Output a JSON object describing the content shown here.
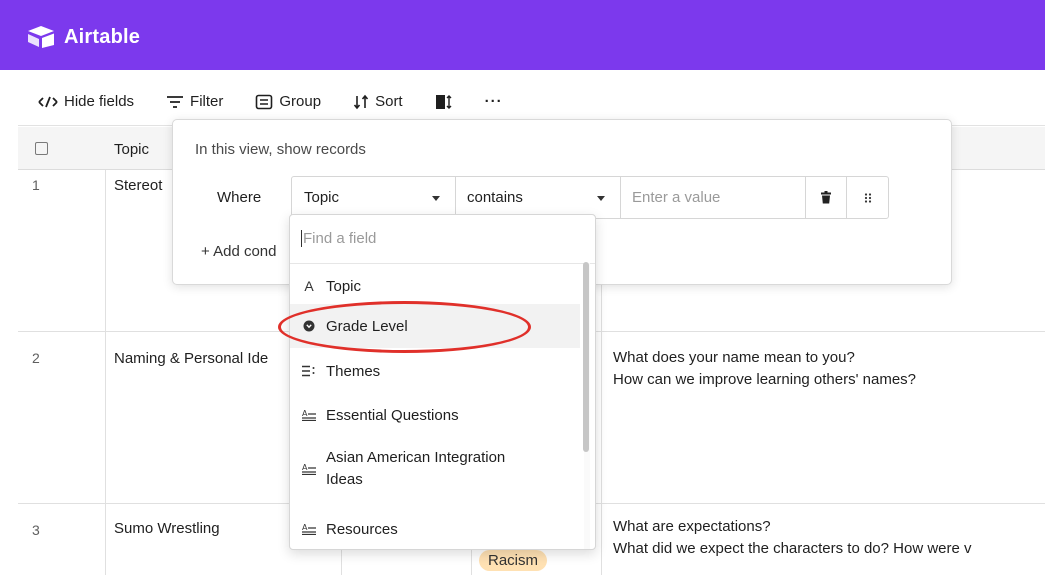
{
  "app": {
    "name": "Airtable",
    "brand_color": "#7c39ed"
  },
  "toolbar": {
    "hide_fields": "Hide fields",
    "filter": "Filter",
    "group": "Group",
    "sort": "Sort",
    "more": "···"
  },
  "grid": {
    "header": {
      "topic": "Topic"
    },
    "rows": [
      {
        "num": "1",
        "topic": "Stereot",
        "questions": []
      },
      {
        "num": "2",
        "topic": "Naming & Personal Ide",
        "questions": [
          "What does your name mean to you?",
          "How can we improve learning others' names?"
        ]
      },
      {
        "num": "3",
        "topic": "Sumo Wrestling",
        "tag": "Racism",
        "questions": [
          "What are expectations?",
          "What did we expect the characters to do? How were v"
        ]
      }
    ]
  },
  "filter_popover": {
    "title": "In this view, show records",
    "where": "Where",
    "field": "Topic",
    "operator": "contains",
    "value_placeholder": "Enter a value",
    "add_condition": "+ Add cond"
  },
  "field_dropdown": {
    "search_placeholder": "Find a field",
    "items": [
      {
        "label": "Topic",
        "icon": "text-icon"
      },
      {
        "label": "Grade Level",
        "icon": "single-select-icon",
        "highlighted": true
      },
      {
        "label": "Themes",
        "icon": "multi-select-icon"
      },
      {
        "label": "Essential Questions",
        "icon": "long-text-icon"
      },
      {
        "label": "Asian American Integration",
        "label2": "Ideas",
        "icon": "long-text-icon"
      },
      {
        "label": "Resources",
        "icon": "long-text-icon"
      }
    ]
  },
  "annotation": {
    "color": "#e0302a"
  }
}
